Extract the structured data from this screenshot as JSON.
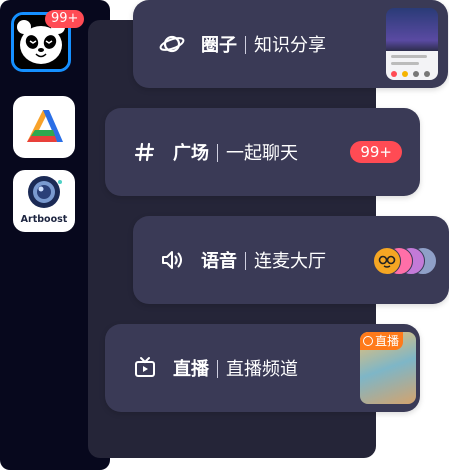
{
  "rail": {
    "badge": "99+",
    "apps": [
      {
        "name": "panda"
      },
      {
        "name": "analytics"
      },
      {
        "name": "Artboost"
      }
    ]
  },
  "cards": [
    {
      "icon": "planet-icon",
      "title": "圈子",
      "subtitle": "知识分享"
    },
    {
      "icon": "hashtag-icon",
      "title": "广场",
      "subtitle": "一起聊天",
      "badge": "99+"
    },
    {
      "icon": "speaker-icon",
      "title": "语音",
      "subtitle": "连麦大厅"
    },
    {
      "icon": "tv-icon",
      "title": "直播",
      "subtitle": "直播频道",
      "live_tag": "直播"
    }
  ],
  "colors": {
    "accent": "#1590ff",
    "badge": "#ff4b54",
    "live": "#ff7a1a",
    "card": "#3a3a56",
    "rail": "#07081d"
  }
}
